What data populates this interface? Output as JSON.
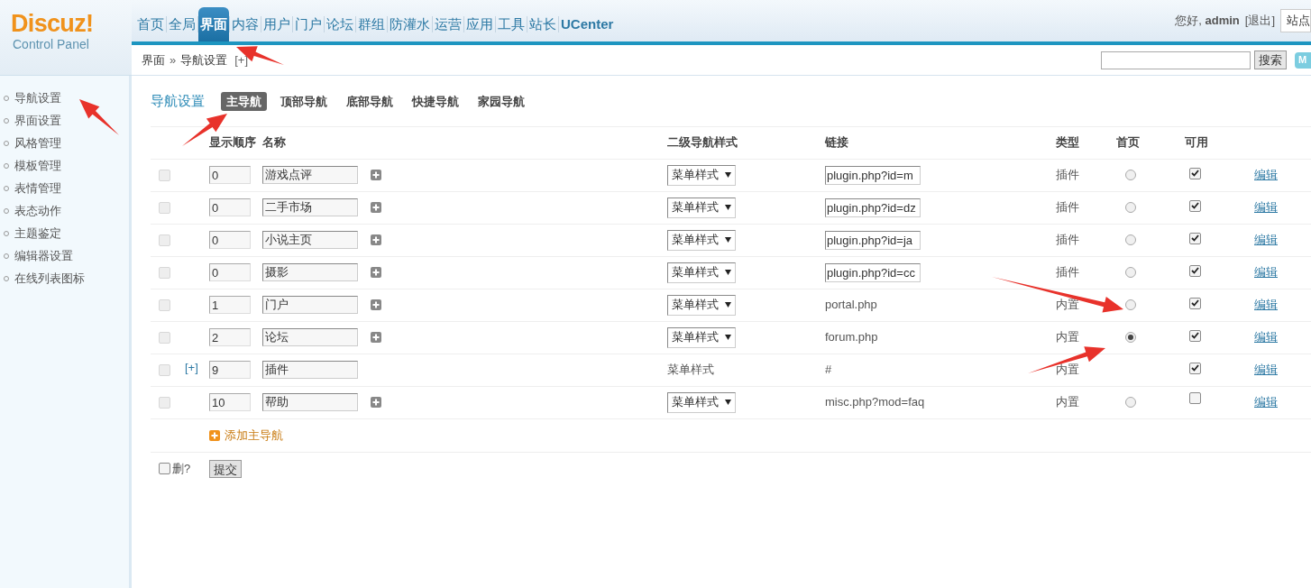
{
  "logo": {
    "name": "Discuz!",
    "subtitle": "Control Panel"
  },
  "top_nav": [
    {
      "label": "首页",
      "selected": false
    },
    {
      "label": "全局",
      "selected": false
    },
    {
      "label": "界面",
      "selected": true
    },
    {
      "label": "内容",
      "selected": false
    },
    {
      "label": "用户",
      "selected": false
    },
    {
      "label": "门户",
      "selected": false
    },
    {
      "label": "论坛",
      "selected": false
    },
    {
      "label": "群组",
      "selected": false
    },
    {
      "label": "防灌水",
      "selected": false
    },
    {
      "label": "运营",
      "selected": false
    },
    {
      "label": "应用",
      "selected": false
    },
    {
      "label": "工具",
      "selected": false
    },
    {
      "label": "站长",
      "selected": false
    },
    {
      "label": "UCenter",
      "selected": false
    }
  ],
  "user": {
    "greeting": "您好,",
    "name": "admin",
    "logout": "[退出]",
    "site_field": "站点"
  },
  "breadcrumb": {
    "section": "界面",
    "separator": "»",
    "page": "导航设置",
    "add": "[+]"
  },
  "search": {
    "button": "搜索",
    "map_button": "M"
  },
  "sidebar": {
    "items": [
      {
        "label": "导航设置"
      },
      {
        "label": "界面设置"
      },
      {
        "label": "风格管理"
      },
      {
        "label": "模板管理"
      },
      {
        "label": "表情管理"
      },
      {
        "label": "表态动作"
      },
      {
        "label": "主题鉴定"
      },
      {
        "label": "编辑器设置"
      },
      {
        "label": "在线列表图标"
      }
    ]
  },
  "heading": "导航设置",
  "sub_tabs": [
    {
      "label": "主导航",
      "selected": true
    },
    {
      "label": "顶部导航",
      "selected": false
    },
    {
      "label": "底部导航",
      "selected": false
    },
    {
      "label": "快捷导航",
      "selected": false
    },
    {
      "label": "家园导航",
      "selected": false
    }
  ],
  "table": {
    "columns": [
      "显示顺序",
      "名称",
      "二级导航样式",
      "链接",
      "类型",
      "首页",
      "可用"
    ],
    "rows": [
      {
        "checked": false,
        "disabled": true,
        "order": "0",
        "name": "游戏点评",
        "add_sub": true,
        "style": {
          "kind": "select",
          "label": "菜单样式"
        },
        "link": {
          "kind": "input",
          "value": "plugin.php?id=m"
        },
        "type": "插件",
        "home": {
          "selected": false
        },
        "enabled": true,
        "edit": "编辑"
      },
      {
        "checked": false,
        "disabled": true,
        "order": "0",
        "name": "二手市场",
        "add_sub": true,
        "style": {
          "kind": "select",
          "label": "菜单样式"
        },
        "link": {
          "kind": "input",
          "value": "plugin.php?id=dz"
        },
        "type": "插件",
        "home": {
          "selected": false
        },
        "enabled": true,
        "edit": "编辑"
      },
      {
        "checked": false,
        "disabled": true,
        "order": "0",
        "name": "小说主页",
        "add_sub": true,
        "style": {
          "kind": "select",
          "label": "菜单样式"
        },
        "link": {
          "kind": "input",
          "value": "plugin.php?id=ja"
        },
        "type": "插件",
        "home": {
          "selected": false
        },
        "enabled": true,
        "edit": "编辑"
      },
      {
        "checked": false,
        "disabled": true,
        "order": "0",
        "name": "摄影",
        "add_sub": true,
        "style": {
          "kind": "select",
          "label": "菜单样式"
        },
        "link": {
          "kind": "input",
          "value": "plugin.php?id=cc"
        },
        "type": "插件",
        "home": {
          "selected": false
        },
        "enabled": true,
        "edit": "编辑"
      },
      {
        "checked": false,
        "disabled": true,
        "order": "1",
        "name": "门户",
        "add_sub": true,
        "style": {
          "kind": "select",
          "label": "菜单样式"
        },
        "link": {
          "kind": "text",
          "value": "portal.php"
        },
        "type": "内置",
        "home": {
          "selected": false
        },
        "enabled": true,
        "edit": "编辑"
      },
      {
        "checked": false,
        "disabled": true,
        "order": "2",
        "name": "论坛",
        "add_sub": true,
        "style": {
          "kind": "select",
          "label": "菜单样式"
        },
        "link": {
          "kind": "text",
          "value": "forum.php"
        },
        "type": "内置",
        "home": {
          "selected": true
        },
        "enabled": true,
        "edit": "编辑"
      },
      {
        "checked": false,
        "disabled": true,
        "expand": "[+]",
        "order": "9",
        "name": "插件",
        "add_sub": false,
        "style": {
          "kind": "text",
          "label": "菜单样式"
        },
        "link": {
          "kind": "text",
          "value": "#"
        },
        "type": "内置",
        "enabled": true,
        "edit": "编辑"
      },
      {
        "checked": false,
        "disabled": true,
        "order": "10",
        "name": "帮助",
        "add_sub": true,
        "style": {
          "kind": "select",
          "label": "菜单样式"
        },
        "link": {
          "kind": "text",
          "value": "misc.php?mod=faq"
        },
        "type": "内置",
        "home": {
          "selected": false
        },
        "enabled": false,
        "edit": "编辑"
      }
    ],
    "add_link": "添加主导航"
  },
  "footer": {
    "delete_label": "删?",
    "delete_checked": false,
    "submit": "提交"
  }
}
